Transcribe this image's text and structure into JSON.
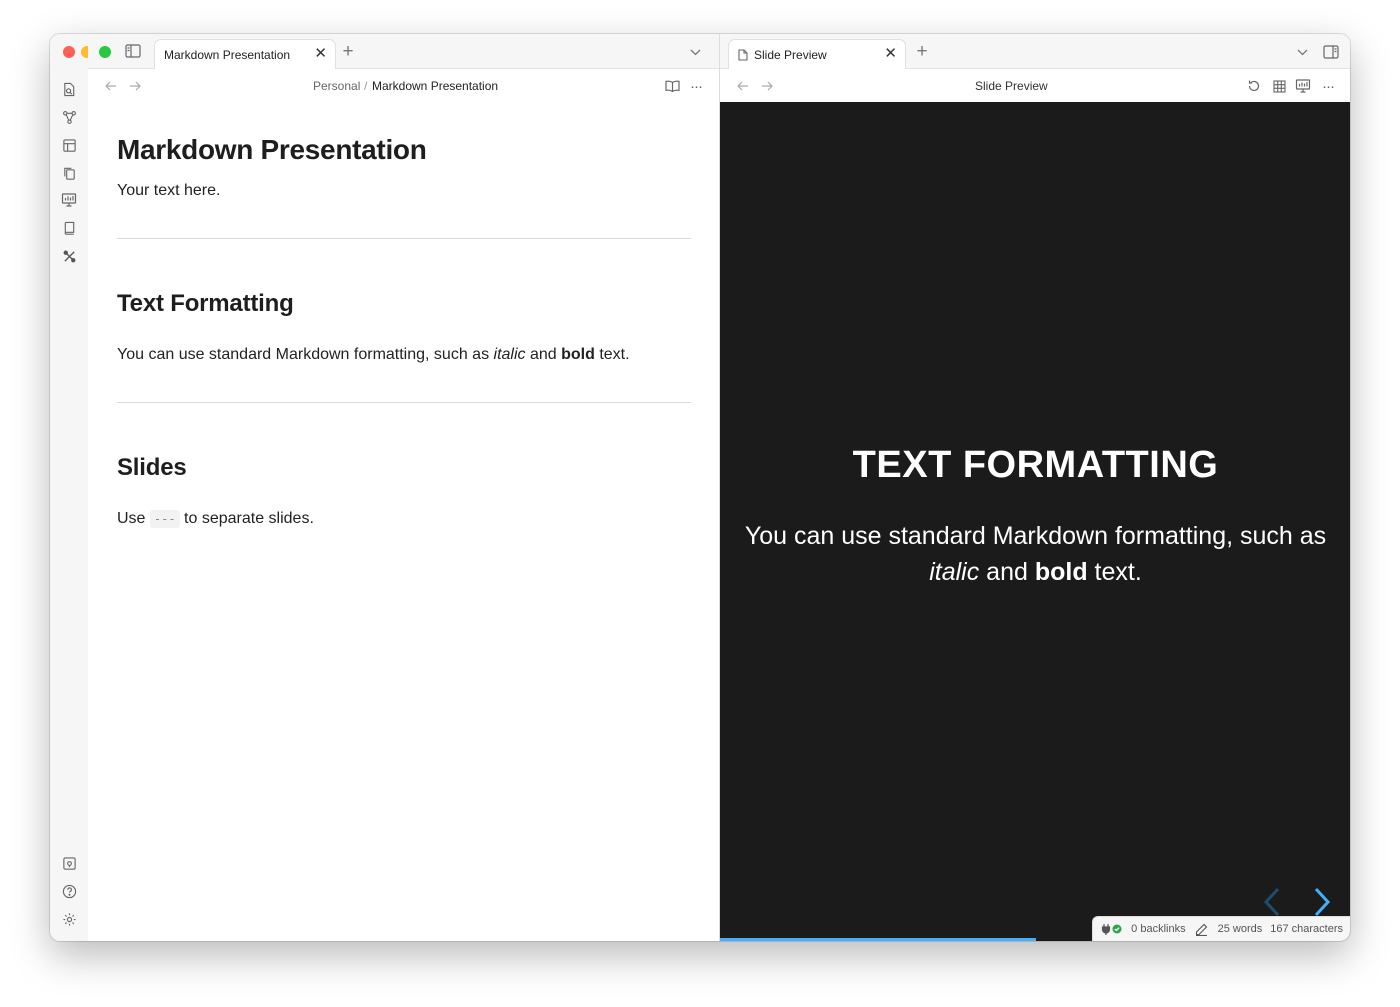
{
  "left_pane": {
    "tab_label": "Markdown Presentation",
    "breadcrumb": {
      "folder": "Personal",
      "separator": "/",
      "file": "Markdown Presentation"
    },
    "document": {
      "title": "Markdown Presentation",
      "intro": "Your text here.",
      "section1_heading": "Text Formatting",
      "section1_text_pre": "You can use standard Markdown formatting, such as ",
      "section1_italic": "italic",
      "section1_and": " and ",
      "section1_bold": "bold",
      "section1_post": " text.",
      "section2_heading": "Slides",
      "section2_pre": "Use ",
      "section2_code": "---",
      "section2_post": " to separate slides."
    }
  },
  "right_pane": {
    "tab_label": "Slide Preview",
    "nav_title": "Slide Preview",
    "slide": {
      "title": "TEXT FORMATTING",
      "line1": "You can use standard Markdown formatting, such as",
      "italic": "italic",
      "and": " and ",
      "bold": "bold",
      "post": " text.",
      "progress": 0.5
    },
    "status": {
      "backlinks": "0 backlinks",
      "words": "25 words",
      "characters": "167 characters"
    }
  },
  "colors": {
    "accent": "#42affa",
    "slide_bg": "#1b1b1b",
    "traffic_red": "#fe5f57",
    "traffic_yellow": "#febc2e",
    "traffic_green": "#28c840"
  }
}
